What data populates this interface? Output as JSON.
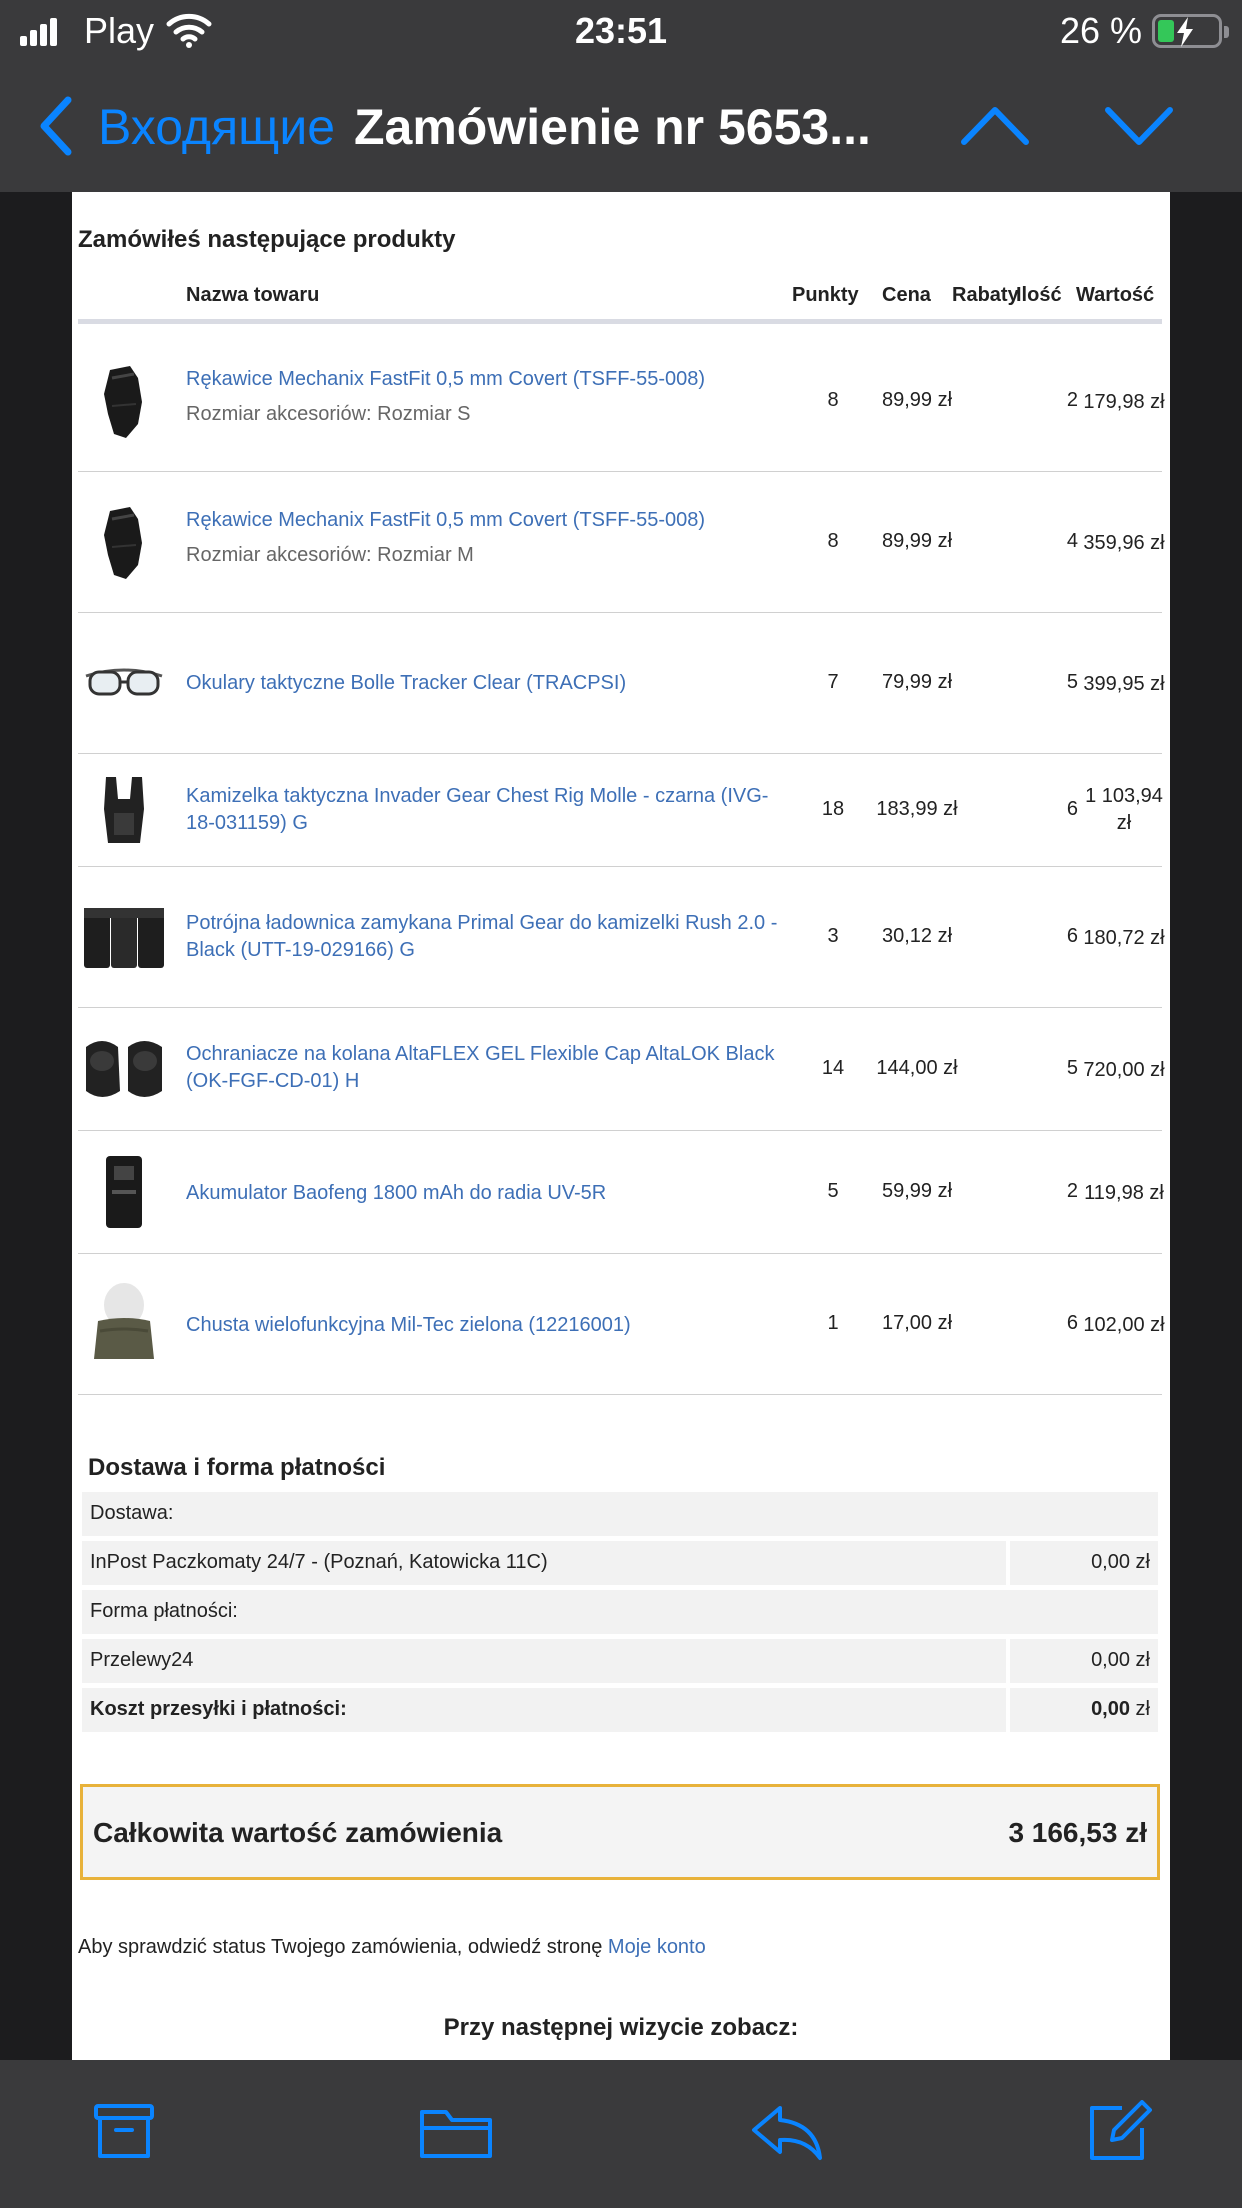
{
  "status": {
    "carrier": "Play",
    "time": "23:51",
    "battery": "26 %"
  },
  "nav": {
    "back_label": "Входящие",
    "title": "Zamówienie nr 5653..."
  },
  "products": {
    "title": "Zamówiłeś następujące produkty",
    "headers": {
      "name": "Nazwa towaru",
      "points": "Punkty",
      "price": "Cena",
      "discount": "Rabaty",
      "qty": "Ilość",
      "value": "Wartość"
    },
    "rows": [
      {
        "icon": "gloves-image",
        "name": "Rękawice Mechanix FastFit 0,5 mm Covert (TSFF-55-008)",
        "attr": "Rozmiar akcesoriów: Rozmiar S",
        "points": "8",
        "price": "89,99 zł",
        "qty": "2",
        "value": "179,98 zł"
      },
      {
        "icon": "gloves-image",
        "name": "Rękawice Mechanix FastFit 0,5 mm Covert (TSFF-55-008)",
        "attr": "Rozmiar akcesoriów: Rozmiar M",
        "points": "8",
        "price": "89,99 zł",
        "qty": "4",
        "value": "359,96 zł"
      },
      {
        "icon": "goggles-image",
        "name": "Okulary taktyczne Bolle Tracker Clear (TRACPSI)",
        "attr": "",
        "points": "7",
        "price": "79,99 zł",
        "qty": "5",
        "value": "399,95 zł"
      },
      {
        "icon": "vest-image",
        "name": "Kamizelka taktyczna Invader Gear Chest Rig Molle - czarna (IVG-18-031159) G",
        "attr": "",
        "points": "18",
        "price": "183,99 zł",
        "qty": "6",
        "value": "1 103,94 zł"
      },
      {
        "icon": "pouch-image",
        "name": "Potrójna ładownica zamykana Primal Gear do kamizelki Rush 2.0 - Black (UTT-19-029166) G",
        "attr": "",
        "points": "3",
        "price": "30,12 zł",
        "qty": "6",
        "value": "180,72 zł"
      },
      {
        "icon": "kneepads-image",
        "name": "Ochraniacze na kolana AltaFLEX GEL Flexible Cap AltaLOK Black (OK-FGF-CD-01) H",
        "attr": "",
        "points": "14",
        "price": "144,00 zł",
        "qty": "5",
        "value": "720,00 zł"
      },
      {
        "icon": "battery-image",
        "name": "Akumulator Baofeng 1800 mAh do radia UV-5R",
        "attr": "",
        "points": "5",
        "price": "59,99 zł",
        "qty": "2",
        "value": "119,98 zł"
      },
      {
        "icon": "scarf-image",
        "name": "Chusta wielofunkcyjna Mil-Tec zielona (12216001)",
        "attr": "",
        "points": "1",
        "price": "17,00 zł",
        "qty": "6",
        "value": "102,00 zł"
      }
    ]
  },
  "shipping": {
    "title": "Dostawa i forma płatności",
    "delivery_label": "Dostawa:",
    "delivery_method": "InPost Paczkomaty 24/7 - (Poznań, Katowicka 11C)",
    "delivery_cost": "0,00 zł",
    "payment_label": "Forma płatności:",
    "payment_method": "Przelewy24",
    "payment_cost": "0,00 zł",
    "total_label": "Koszt przesyłki i płatności:",
    "total_value": "0,00",
    "total_unit": " zł"
  },
  "total": {
    "label": "Całkowita wartość zamówienia",
    "amount": "3 166,53 zł"
  },
  "info": {
    "text": "Aby sprawdzić status Twojego zamówienia, odwiedź stronę ",
    "link": "Moje konto"
  },
  "next_visit": "Przy następnej wizycie zobacz:",
  "colors": {
    "accent": "#0a84ff",
    "link": "#3d6fb6",
    "total_border": "#e8b23a",
    "bar": "#3a3a3c"
  }
}
